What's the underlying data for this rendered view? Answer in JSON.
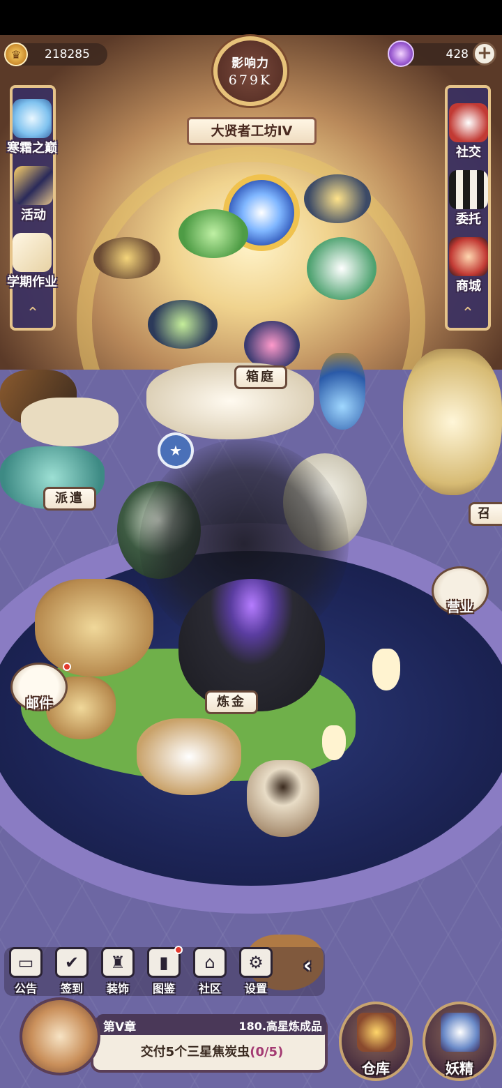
{
  "currency": {
    "coins": "218285",
    "gems": "428",
    "coin_icon": "crown-coin-icon",
    "gem_icon": "purple-gem-icon"
  },
  "influence": {
    "label": "影响力",
    "value": "679K",
    "workshop_title": "大贤者工坊IV"
  },
  "left_menu": [
    {
      "label": "寒霜之巅",
      "icon": "ice-crystal-icon"
    },
    {
      "label": "活动",
      "icon": "event-banner-icon"
    },
    {
      "label": "学期作业",
      "icon": "scroll-icon"
    }
  ],
  "right_menu": [
    {
      "label": "社交",
      "icon": "birds-icon"
    },
    {
      "label": "委托",
      "icon": "notice-board-icon"
    },
    {
      "label": "商城",
      "icon": "shop-character-icon"
    }
  ],
  "scene_tags": {
    "garden": "箱庭",
    "dispatch": "派遣",
    "summon": "召",
    "business": "营业",
    "mail": "邮件",
    "alchemy": "炼金"
  },
  "toolbar": [
    {
      "label": "公告",
      "icon": "notice-icon",
      "glyph": "▭"
    },
    {
      "label": "签到",
      "icon": "calendar-check-icon",
      "glyph": "✔"
    },
    {
      "label": "装饰",
      "icon": "castle-icon",
      "glyph": "♜"
    },
    {
      "label": "图鉴",
      "icon": "book-icon",
      "glyph": "▮"
    },
    {
      "label": "社区",
      "icon": "house-icon",
      "glyph": "⌂"
    },
    {
      "label": "设置",
      "icon": "gear-icon",
      "glyph": "⚙"
    }
  ],
  "toolbar_collapse_glyph": "‹",
  "quest": {
    "chapter": "第V章",
    "step": "180.高星炼成品",
    "description": "交付5个三星焦炭虫",
    "progress": "(0/5)"
  },
  "bottom_buttons": {
    "warehouse": "仓库",
    "fairy": "妖精"
  },
  "colors": {
    "panel_border": "#e6c48a",
    "panel_fill": "#3a3062",
    "quest_progress": "#a33a72",
    "notification": "#e33a2e"
  }
}
